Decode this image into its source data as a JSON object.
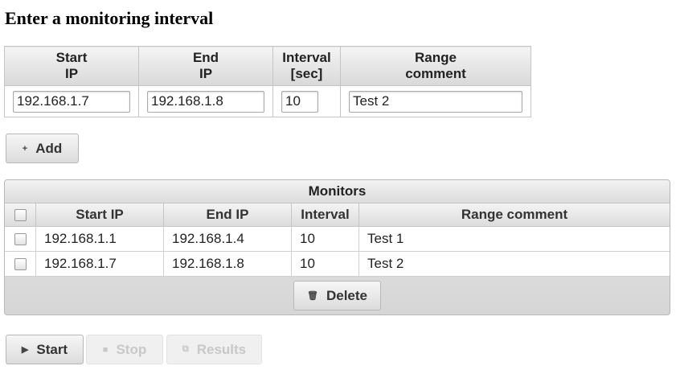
{
  "page": {
    "title": "Enter a monitoring interval"
  },
  "entry": {
    "headers": {
      "start_ip_line1": "Start",
      "start_ip_line2": "IP",
      "end_ip_line1": "End",
      "end_ip_line2": "IP",
      "interval_line1": "Interval",
      "interval_line2": "[sec]",
      "comment_line1": "Range",
      "comment_line2": "comment"
    },
    "values": {
      "start_ip": "192.168.1.7",
      "end_ip": "192.168.1.8",
      "interval": "10",
      "comment": "Test 2"
    },
    "add_label": "Add",
    "add_icon": "plus-icon"
  },
  "monitors": {
    "title": "Monitors",
    "columns": {
      "start_ip": "Start IP",
      "end_ip": "End IP",
      "interval": "Interval",
      "comment": "Range comment"
    },
    "rows": [
      {
        "start_ip": "192.168.1.1",
        "end_ip": "192.168.1.4",
        "interval": "10",
        "comment": "Test 1"
      },
      {
        "start_ip": "192.168.1.7",
        "end_ip": "192.168.1.8",
        "interval": "10",
        "comment": "Test 2"
      }
    ],
    "delete_label": "Delete",
    "delete_icon": "trash-icon"
  },
  "controls": {
    "start_label": "Start",
    "start_icon": "play-icon",
    "stop_label": "Stop",
    "stop_icon": "stop-icon",
    "results_label": "Results",
    "results_icon": "copy-icon"
  }
}
